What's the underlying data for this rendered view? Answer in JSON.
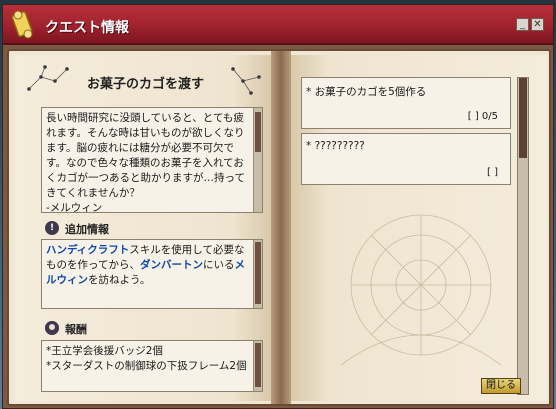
{
  "window": {
    "title": "クエスト情報",
    "minimize_label": "_",
    "close_label": "✕"
  },
  "quest": {
    "title": "お菓子のカゴを渡す",
    "description": "長い時間研究に没頭していると、とても疲れます。そんな時は甘いものが欲しくなります。脳の疲れには糖分が必要不可欠です。なので色々な種類のお菓子を入れておくカゴが一つあると助かりますが…持ってきてくれませんか？",
    "signature": "-メルウィン"
  },
  "extra_info": {
    "heading": "追加情報",
    "icon_label": "!",
    "parts": [
      {
        "text": "ハンディクラフト",
        "highlight": true
      },
      {
        "text": "スキルを使用して必要なものを作ってから、",
        "highlight": false
      },
      {
        "text": "ダンバートン",
        "highlight": true
      },
      {
        "text": "にいる",
        "highlight": false
      },
      {
        "text": "メルウィン",
        "highlight": true
      },
      {
        "text": "を訪ねよう。",
        "highlight": false
      }
    ]
  },
  "reward": {
    "heading": "報酬",
    "items": [
      "*王立学会後援バッジ2個",
      "*スターダストの制御球の下扱フレーム2個"
    ]
  },
  "objectives": [
    {
      "label": "* お菓子のカゴを5個作る",
      "count": "[   ] 0/5"
    },
    {
      "label": "* ?????????",
      "count": "[   ]"
    }
  ],
  "buttons": {
    "close_quest": "閉じる"
  }
}
